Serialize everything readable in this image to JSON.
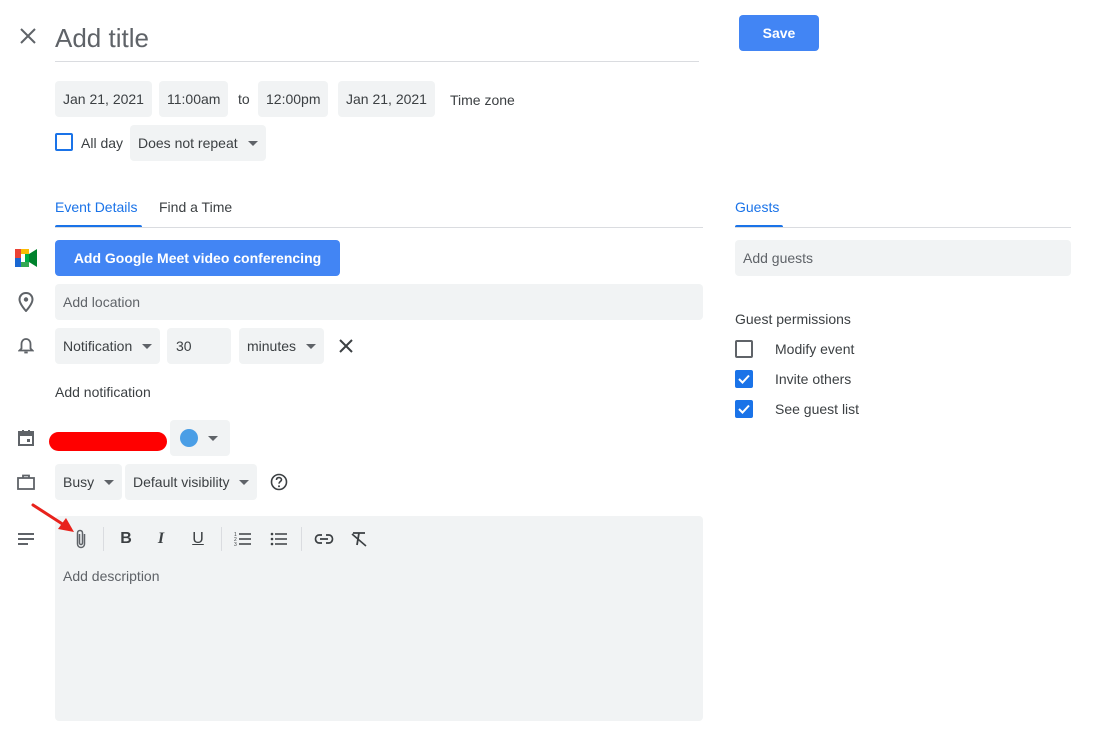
{
  "header": {
    "title_placeholder": "Add title",
    "save_label": "Save"
  },
  "datetime": {
    "start_date": "Jan 21, 2021",
    "start_time": "11:00am",
    "to_label": "to",
    "end_time": "12:00pm",
    "end_date": "Jan 21, 2021",
    "timezone_label": "Time zone",
    "all_day_label": "All day",
    "repeat_value": "Does not repeat"
  },
  "tabs": {
    "event_details": "Event Details",
    "find_time": "Find a Time"
  },
  "details": {
    "meet_button": "Add Google Meet video conferencing",
    "location_placeholder": "Add location",
    "notification_type": "Notification",
    "notification_value": "30",
    "notification_unit": "minutes",
    "add_notification": "Add notification",
    "availability": "Busy",
    "visibility": "Default visibility",
    "description_placeholder": "Add description"
  },
  "guests": {
    "tab_label": "Guests",
    "add_placeholder": "Add guests",
    "permissions_title": "Guest permissions",
    "permissions": [
      {
        "label": "Modify event",
        "checked": false
      },
      {
        "label": "Invite others",
        "checked": true
      },
      {
        "label": "See guest list",
        "checked": true
      }
    ]
  },
  "icons": {
    "close": "close-icon",
    "meet": "google-meet-icon",
    "location": "location-pin-icon",
    "notification": "bell-icon",
    "calendar": "calendar-icon",
    "busy": "briefcase-icon",
    "description": "description-lines-icon",
    "help": "help-circle-icon",
    "attach": "paperclip-icon",
    "bold": "bold-icon",
    "italic": "italic-icon",
    "underline": "underline-icon",
    "numbered_list": "numbered-list-icon",
    "bulleted_list": "bulleted-list-icon",
    "link": "link-icon",
    "clear_format": "clear-format-icon"
  },
  "colors": {
    "accent": "#1a73e8",
    "save_button": "#4285f4",
    "event_color": "#4a9ee6",
    "redaction": "#ff0000",
    "annotation_arrow": "#e8221c"
  }
}
